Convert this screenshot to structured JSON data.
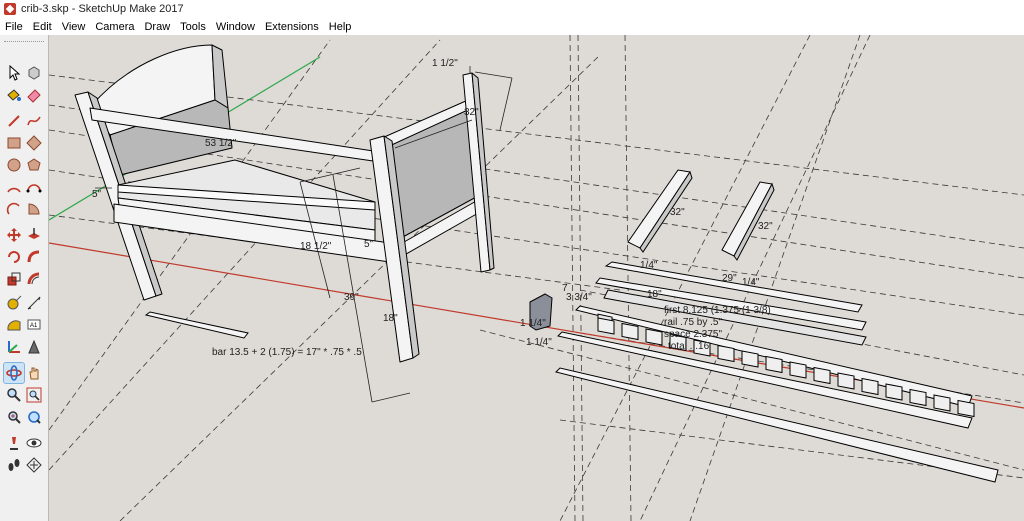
{
  "window": {
    "title": "crib-3.skp - SketchUp Make 2017"
  },
  "menu": [
    "File",
    "Edit",
    "View",
    "Camera",
    "Draw",
    "Tools",
    "Window",
    "Extensions",
    "Help"
  ],
  "tools": [
    "select-icon",
    "make-component-icon",
    "paint-bucket-icon",
    "eraser-icon",
    "line-icon",
    "freehand-icon",
    "rectangle-icon",
    "rotated-rectangle-icon",
    "circle-icon",
    "polygon-icon",
    "arc-icon",
    "two-point-arc-icon",
    "three-point-arc-icon",
    "pie-icon",
    "move-icon",
    "push-pull-icon",
    "rotate-icon",
    "follow-me-icon",
    "scale-icon",
    "offset-icon",
    "tape-measure-icon",
    "dimension-icon",
    "protractor-icon",
    "text-icon",
    "axes-icon",
    "3d-text-icon",
    "orbit-icon",
    "pan-icon",
    "zoom-icon",
    "zoom-window-icon",
    "zoom-extents-icon",
    "previous-view-icon",
    "position-camera-icon",
    "look-around-icon",
    "walk-icon",
    "section-plane-icon"
  ],
  "labels": {
    "d_1_half": "1 1/2\"",
    "d_32_top": "32\"",
    "d_53": "53 1/2\"",
    "d_5_left": "5\"",
    "d_18_half": "18 1/2\"",
    "d_5_mid": "5\"",
    "d_39": "39\"",
    "d_18_right": "18\"",
    "d_32_slat1": "32\"",
    "d_32_slat2": "32\"",
    "d_1_4_a": "1/4\"",
    "d_29": "29\"",
    "d_1_4_b": "1/4\"",
    "d_18_small": "18\"",
    "d_3_4": "3 3/4\"",
    "d_7": "7",
    "d_1_4_c": "1 1/4\"",
    "d_1_4_d": "1 1/4\"",
    "note_first": "first 8.125 (1.375 (1 3/8)",
    "note_rail": "rail .75 by .5\"",
    "note_space": "space 2.375\"",
    "note_total": "total ...16",
    "note_bar": "bar 13.5 + 2 (1.75) = 17\" * .75 * .5"
  },
  "colors": {
    "viewport_bg": "#dedad5",
    "red_axis": "#c0392b",
    "green_axis": "#2aa84a",
    "face_light": "#f4f4f4",
    "face_gray": "#b7b7b7",
    "face_dark": "#c9c9c9",
    "guide": "#3a3a3a"
  }
}
